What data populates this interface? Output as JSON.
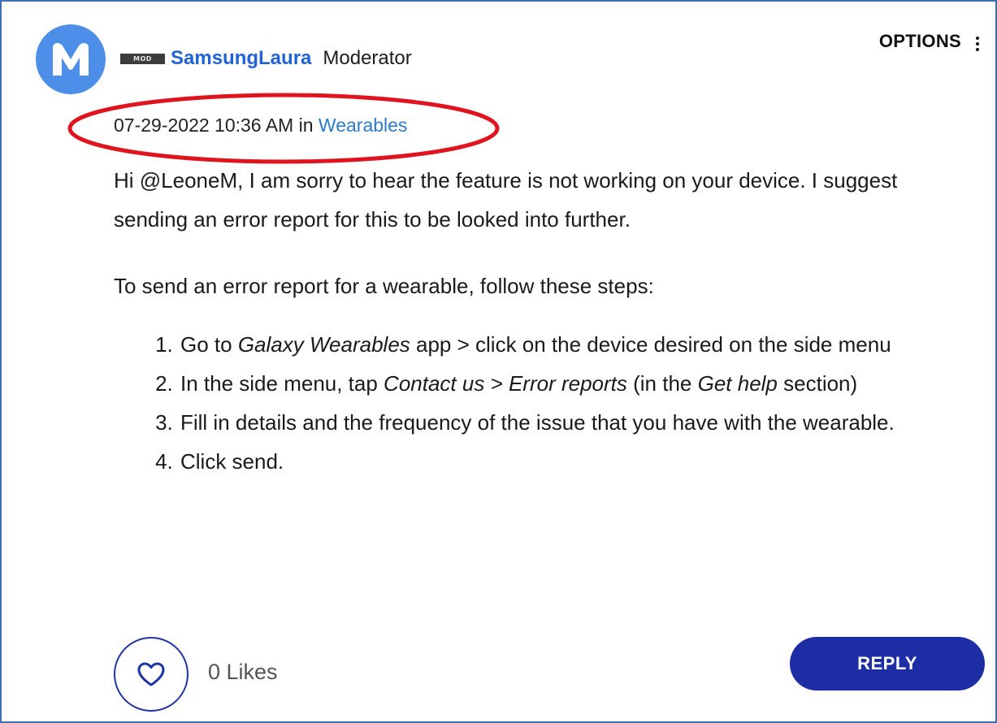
{
  "author": {
    "badge": "MOD",
    "name": "SamsungLaura",
    "role": "Moderator",
    "avatar_icon": "user-avatar-m-icon"
  },
  "header": {
    "options_label": "OPTIONS",
    "options_icon": "kebab-menu-icon"
  },
  "meta": {
    "timestamp": "07-29-2022 10:36 AM",
    "in_text": "in",
    "board": "Wearables"
  },
  "post": {
    "intro": "Hi @LeoneM, I am sorry to hear the feature is not working on your device. I suggest sending an error report for this to be looked into further.",
    "lead": "To send an error report for a wearable, follow these steps:",
    "steps": {
      "s1": {
        "a": "Go to ",
        "b": "Galaxy Wearables",
        "c": " app > click on the device desired on the side menu"
      },
      "s2": {
        "a": "In the side menu, tap ",
        "b": "Contact us > Error reports",
        "c": " (in the ",
        "d": "Get help",
        "e": " section)"
      },
      "s3": {
        "a": "Fill in details and the frequency of the issue that you have with the wearable."
      },
      "s4": {
        "a": "Click send."
      }
    }
  },
  "footer": {
    "likes": "0 Likes",
    "like_icon": "heart-icon",
    "reply_label": "REPLY"
  },
  "colors": {
    "accent": "#1d2ea5",
    "link": "#1f63d6",
    "avatar": "#4d8fe8",
    "highlight": "#e0141e"
  }
}
